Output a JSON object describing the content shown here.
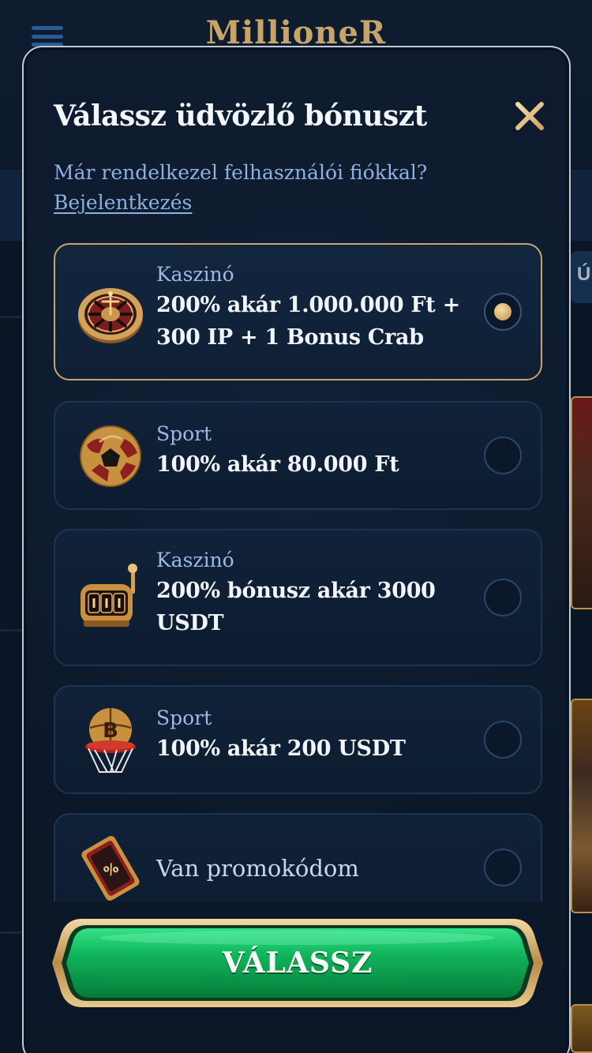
{
  "background": {
    "logo_text": "MillioneR",
    "side_tab_text": "Ú"
  },
  "modal": {
    "title": "Válassz üdvözlő bónuszt",
    "account_prompt": "Már rendelkezel felhasználói fiókkal?",
    "login_link": "Bejelentkezés",
    "options": [
      {
        "category": "Kaszinó",
        "title": "200% akár 1.000.000 Ft + 300 IP + 1 Bonus Crab",
        "icon": "roulette-icon",
        "selected": true
      },
      {
        "category": "Sport",
        "title": "100% akár 80.000 Ft",
        "icon": "soccer-ball-icon",
        "selected": false
      },
      {
        "category": "Kaszinó",
        "title": "200% bónusz akár 3000 USDT",
        "icon": "slot-machine-icon",
        "selected": false
      },
      {
        "category": "Sport",
        "title": "100% akár 200 USDT",
        "icon": "basketball-hoop-icon",
        "selected": false
      },
      {
        "label": "Van promokódom",
        "icon": "promo-ticket-icon",
        "selected": false
      }
    ],
    "submit_label": "VÁLASSZ"
  },
  "colors": {
    "accent_gold": "#c9a46a",
    "button_green": "#0fa553",
    "link_blue": "#8fb0e0",
    "background": "#0a1524"
  }
}
